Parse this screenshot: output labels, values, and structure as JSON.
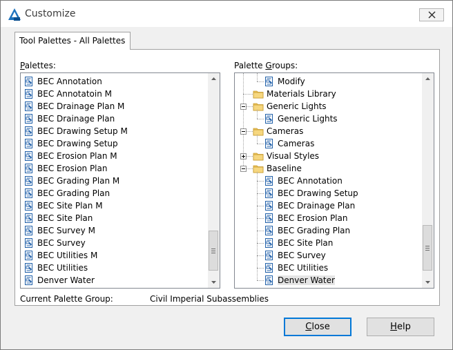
{
  "window": {
    "title": "Customize"
  },
  "tabs": [
    {
      "label": "Tool Palettes - All Palettes"
    }
  ],
  "palettes": {
    "label_u": "P",
    "label_rest": "alettes:",
    "items": [
      "BEC Annotation",
      "BEC Annotatoin M",
      "BEC Drainage Plan M",
      "BEC Drainage Plan",
      "BEC Drawing Setup M",
      "BEC Drawing Setup",
      "BEC Erosion Plan M",
      "BEC Erosion Plan",
      "BEC Grading Plan M",
      "BEC Grading Plan",
      "BEC Site Plan M",
      "BEC Site Plan",
      "BEC Survey M",
      "BEC Survey",
      "BEC Utilities M",
      "BEC Utilities",
      "Denver Water"
    ]
  },
  "palette_groups": {
    "label_pre": "Palette ",
    "label_u": "G",
    "label_rest": "roups:",
    "tree": [
      {
        "text": "Modify",
        "level": 1,
        "icon": "palette-icon"
      },
      {
        "text": "Materials Library",
        "level": 0,
        "icon": "folder-icon"
      },
      {
        "text": "Generic Lights",
        "level": 0,
        "icon": "folder-icon",
        "expander": "minus"
      },
      {
        "text": "Generic Lights",
        "level": 1,
        "icon": "palette-icon"
      },
      {
        "text": "Cameras",
        "level": 0,
        "icon": "folder-icon",
        "expander": "minus"
      },
      {
        "text": "Cameras",
        "level": 1,
        "icon": "palette-icon"
      },
      {
        "text": "Visual Styles",
        "level": 0,
        "icon": "folder-icon",
        "expander": "plus"
      },
      {
        "text": "Baseline",
        "level": 0,
        "icon": "folder-icon",
        "expander": "minus"
      },
      {
        "text": "BEC Annotation",
        "level": 1,
        "icon": "palette-icon"
      },
      {
        "text": "BEC Drawing Setup",
        "level": 1,
        "icon": "palette-icon"
      },
      {
        "text": "BEC Drainage Plan",
        "level": 1,
        "icon": "palette-icon"
      },
      {
        "text": "BEC Erosion Plan",
        "level": 1,
        "icon": "palette-icon"
      },
      {
        "text": "BEC Grading Plan",
        "level": 1,
        "icon": "palette-icon"
      },
      {
        "text": "BEC Site Plan",
        "level": 1,
        "icon": "palette-icon"
      },
      {
        "text": "BEC Survey",
        "level": 1,
        "icon": "palette-icon"
      },
      {
        "text": "BEC Utilities",
        "level": 1,
        "icon": "palette-icon"
      },
      {
        "text": "Denver Water",
        "level": 1,
        "icon": "palette-icon",
        "selected": true
      }
    ]
  },
  "current_group": {
    "label": "Current Palette Group:",
    "value": "Civil Imperial Subassemblies"
  },
  "buttons": {
    "close_u": "C",
    "close_rest": "lose",
    "help_u": "H",
    "help_rest": "elp"
  },
  "colors": {
    "accent": "#0078d7",
    "folder": "#f0c75e",
    "palette_icon": "#1f5fa8"
  }
}
